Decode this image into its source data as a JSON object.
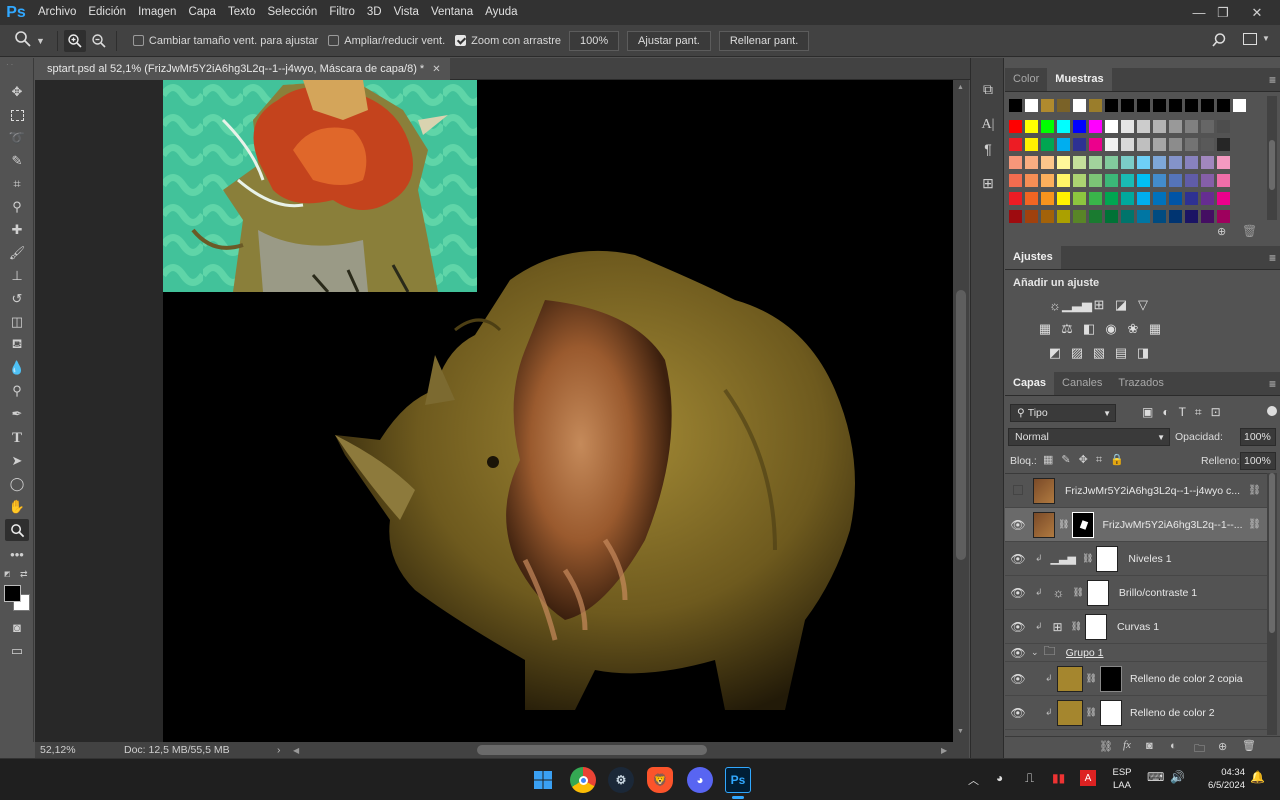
{
  "app": {
    "logo": "Ps"
  },
  "menubar": {
    "items": [
      "Archivo",
      "Edición",
      "Imagen",
      "Capa",
      "Texto",
      "Selección",
      "Filtro",
      "3D",
      "Vista",
      "Ventana",
      "Ayuda"
    ]
  },
  "options": {
    "resize_windows": "Cambiar tamaño vent. para ajustar",
    "zoom_all": "Ampliar/reducir vent.",
    "scrubby_zoom": "Zoom con arrastre",
    "zoom_value": "100%",
    "fit_screen": "Ajustar pant.",
    "fill_screen": "Rellenar pant."
  },
  "document": {
    "tab_title": "sptart.psd al 52,1% (FrizJwMr5Y2iA6hg3L2q--1--j4wyo, Máscara de capa/8) *",
    "zoom": "52,12%",
    "doc_size": "Doc: 12,5 MB/55,5 MB"
  },
  "swatches_panel": {
    "tabs": [
      "Color",
      "Muestras"
    ],
    "active_tab": "Muestras",
    "recent": [
      "#000000",
      "#ffffff",
      "#b08a2e",
      "#7a6228",
      "#ffffff",
      "#9a7d2b",
      "#000000",
      "#000000",
      "#000000",
      "#000000",
      "#000000",
      "#000000",
      "#000000",
      "#000000",
      "#ffffff"
    ],
    "row1": [
      "#ff0000",
      "#ffff00",
      "#00ff00",
      "#00ffff",
      "#0000ff",
      "#ff00ff",
      "#ffffff",
      "#e5e5e5",
      "#cccccc",
      "#b3b3b3",
      "#999999",
      "#808080",
      "#666666",
      "#4d4d4d"
    ],
    "row2": [
      "#ed1c24",
      "#fff200",
      "#00a651",
      "#00aeef",
      "#2e3192",
      "#ec008c",
      "#f2f2f2",
      "#d9d9d9",
      "#bfbfbf",
      "#a6a6a6",
      "#8c8c8c",
      "#737373",
      "#595959",
      "#262626"
    ],
    "row3": [
      "#f7977a",
      "#f9ad81",
      "#fdc68a",
      "#fff79a",
      "#c4df9b",
      "#a2d39c",
      "#82ca9d",
      "#7bcdc8",
      "#6ecff6",
      "#7ea7d8",
      "#8493ca",
      "#8882be",
      "#a187be",
      "#f49ac1"
    ],
    "row4": [
      "#f26c4f",
      "#f68e55",
      "#fbaf5c",
      "#fff467",
      "#acd372",
      "#7cc576",
      "#3bb878",
      "#1abbb4",
      "#00bff3",
      "#438ccb",
      "#5574b9",
      "#605ca8",
      "#855fa8",
      "#f06ea9"
    ],
    "row5": [
      "#ed1c24",
      "#f26522",
      "#f7941d",
      "#fff200",
      "#8dc63f",
      "#39b54a",
      "#00a651",
      "#00a99d",
      "#00aeef",
      "#0072bc",
      "#0054a6",
      "#2e3192",
      "#662d91",
      "#ec008c"
    ],
    "row6": [
      "#9e0b0f",
      "#a0410d",
      "#a36209",
      "#aba000",
      "#598527",
      "#1a7b30",
      "#007236",
      "#00746b",
      "#0076a3",
      "#004b80",
      "#003471",
      "#1b1464",
      "#440e62",
      "#9e005d"
    ]
  },
  "adjustments_panel": {
    "title": "Ajustes",
    "subtitle": "Añadir un ajuste",
    "icons": [
      "brightness-icon",
      "levels-icon",
      "curves-icon",
      "exposure-icon",
      "vibrance-icon",
      "hsl-icon",
      "color-balance-icon",
      "bw-icon",
      "photo-filter-icon",
      "channel-mixer-icon",
      "color-lookup-icon",
      "invert-icon",
      "posterize-icon",
      "threshold-icon",
      "gradient-map-icon",
      "selective-color-icon"
    ]
  },
  "layers_panel": {
    "tabs": [
      "Capas",
      "Canales",
      "Trazados"
    ],
    "active_tab": "Capas",
    "filter_kind": "Tipo",
    "blend_mode": "Normal",
    "opacity_label": "Opacidad:",
    "opacity": "100%",
    "lock_label": "Bloq.:",
    "fill_label": "Relleno:",
    "fill": "100%",
    "layers": [
      {
        "name": "FrizJwMr5Y2iA6hg3L2q--1--j4wyo c...",
        "visible": false,
        "selected": false
      },
      {
        "name": "FrizJwMr5Y2iA6hg3L2q--1--...",
        "visible": true,
        "selected": true
      },
      {
        "name": "Niveles 1",
        "visible": true,
        "selected": false
      },
      {
        "name": "Brillo/contraste 1",
        "visible": true,
        "selected": false
      },
      {
        "name": "Curvas 1",
        "visible": true,
        "selected": false
      },
      {
        "name": "Grupo 1",
        "visible": true,
        "selected": false
      },
      {
        "name": "Relleno de color 2 copia",
        "visible": true,
        "selected": false
      },
      {
        "name": "Relleno de color 2",
        "visible": true,
        "selected": false
      }
    ]
  },
  "taskbar": {
    "lang_top": "ESP",
    "lang_bottom": "LAA",
    "time": "04:34",
    "date": "6/5/2024"
  },
  "colors": {
    "accent": "#31a8ff",
    "fill_gold": "#a5862e"
  }
}
